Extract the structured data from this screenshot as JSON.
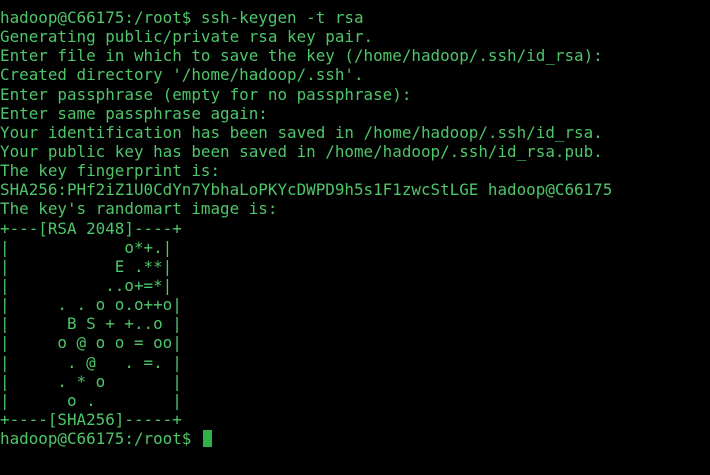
{
  "terminal": {
    "colors": {
      "background": "#000000",
      "foreground": "#4fc56a",
      "cursor": "#2fb14a"
    },
    "lines": [
      "hadoop@C66175:/root$ ssh-keygen -t rsa",
      "Generating public/private rsa key pair.",
      "Enter file in which to save the key (/home/hadoop/.ssh/id_rsa):",
      "Created directory '/home/hadoop/.ssh'.",
      "Enter passphrase (empty for no passphrase):",
      "Enter same passphrase again:",
      "Your identification has been saved in /home/hadoop/.ssh/id_rsa.",
      "Your public key has been saved in /home/hadoop/.ssh/id_rsa.pub.",
      "The key fingerprint is:",
      "SHA256:PHf2iZ1U0CdYn7YbhaLoPKYcDWPD9h5s1F1zwcStLGE hadoop@C66175",
      "The key's randomart image is:",
      "+---[RSA 2048]----+",
      "|            o*+.|",
      "|           E .**|",
      "|          ..o+=*|",
      "|     . . o o.o++o|",
      "|      B S + +..o |",
      "|     o @ o o = oo|",
      "|      . @   . =. |",
      "|     . * o       |",
      "|      o .        |",
      "+----[SHA256]-----+"
    ],
    "prompt": "hadoop@C66175:/root$ "
  }
}
